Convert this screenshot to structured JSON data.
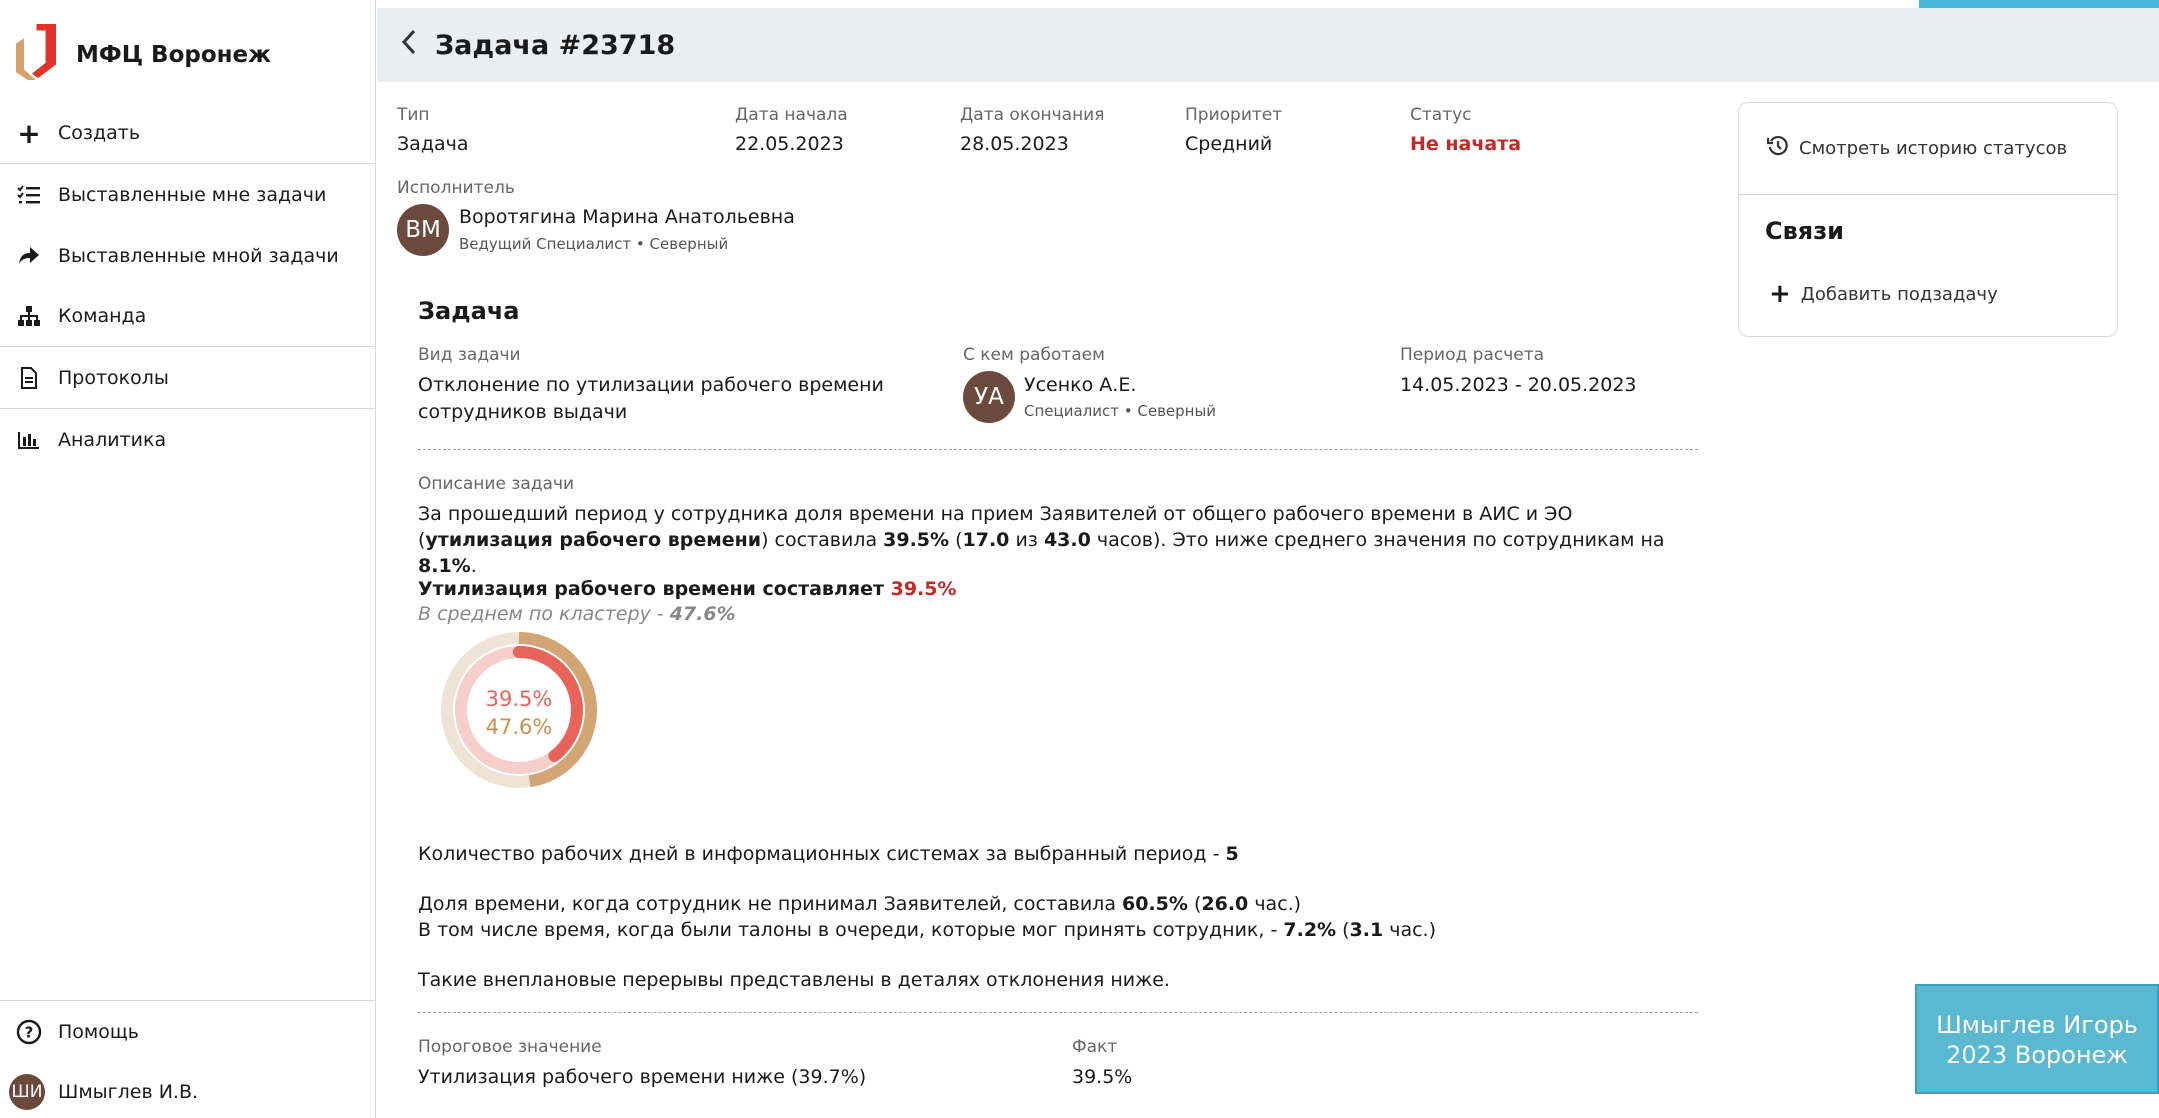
{
  "app": {
    "brand_title": "МФЦ Воронеж"
  },
  "sidebar": {
    "items": [
      {
        "label": "Создать",
        "icon": "plus-icon"
      },
      {
        "label": "Выставленные мне задачи",
        "icon": "checklist-icon"
      },
      {
        "label": "Выставленные мной задачи",
        "icon": "share-arrow-icon"
      },
      {
        "label": "Команда",
        "icon": "org-chart-icon"
      },
      {
        "label": "Протоколы",
        "icon": "document-icon"
      },
      {
        "label": "Аналитика",
        "icon": "bar-chart-icon"
      }
    ],
    "help_label": "Помощь",
    "user": {
      "initials": "ШИ",
      "name": "Шмыглев И.В."
    }
  },
  "header": {
    "title": "Задача #23718"
  },
  "task": {
    "type_label": "Тип",
    "type_value": "Задача",
    "start_label": "Дата начала",
    "start_value": "22.05.2023",
    "end_label": "Дата окончания",
    "end_value": "28.05.2023",
    "priority_label": "Приоритет",
    "priority_value": "Средний",
    "status_label": "Статус",
    "status_value": "Не начата",
    "status_color": "#c62828",
    "executor_label": "Исполнитель",
    "executor": {
      "initials": "ВМ",
      "name": "Воротягина Марина Анатольевна",
      "role": "Ведущий Специалист • Северный"
    }
  },
  "details": {
    "section_title": "Задача",
    "kind_label": "Вид задачи",
    "kind_value_line1": "Отклонение по утилизации рабочего времени",
    "kind_value_line2": "сотрудников выдачи",
    "with_label": "С кем работаем",
    "with_person": {
      "initials": "УА",
      "name": "Усенко А.Е.",
      "role": "Специалист • Северный"
    },
    "period_label": "Период расчета",
    "period_value": "14.05.2023 - 20.05.2023",
    "description_label": "Описание задачи",
    "description": {
      "p1": "За прошедший период у сотрудника доля времени на прием Заявителей от общего рабочего времени в АИС и ЭО (",
      "b1": "утилизация рабочего времени",
      "p2": ") составила ",
      "b2": "39.5%",
      "p3": " (",
      "b3": "17.0",
      "p4": " из ",
      "b4": "43.0",
      "p5": " часов). Это ниже среднего значения по сотрудникам на ",
      "b5": "8.1%",
      "p6": "."
    },
    "utilization": {
      "title_prefix": "Утилизация рабочего времени составляет ",
      "title_value": "39.5%",
      "avg_prefix": "В среднем по кластеру - ",
      "avg_value": "47.6%",
      "employee_fraction": 0.395,
      "cluster_fraction": 0.476,
      "employee_color": "#e8645a",
      "cluster_color": "#d4a574"
    },
    "work_days": {
      "text": "Количество рабочих дней в информационных системах за выбранный период - ",
      "value": "5"
    },
    "idle": {
      "t1": "Доля времени, когда сотрудник не принимал Заявителей, составила ",
      "v1": "60.5%",
      "t2": " (",
      "v2": "26.0",
      "t3": " час.)",
      "t4": "В том числе время, когда были талоны в очереди, которые мог принять сотрудник, - ",
      "v3": "7.2%",
      "t5": " (",
      "v4": "3.1",
      "t6": " час.)"
    },
    "breaks_text": "Такие внеплановые перерывы представлены в деталях отклонения ниже.",
    "threshold_label": "Пороговое значение",
    "threshold_value": "Утилизация рабочего времени ниже (39.7%)",
    "fact_label": "Факт",
    "fact_value": "39.5%"
  },
  "right_panel": {
    "history_label": "Смотреть историю статусов",
    "links_title": "Связи",
    "add_subtask_label": "Добавить подзадачу"
  },
  "watermark": {
    "line1": "Шмыглев Игорь",
    "line2": "2023  Воронеж"
  }
}
